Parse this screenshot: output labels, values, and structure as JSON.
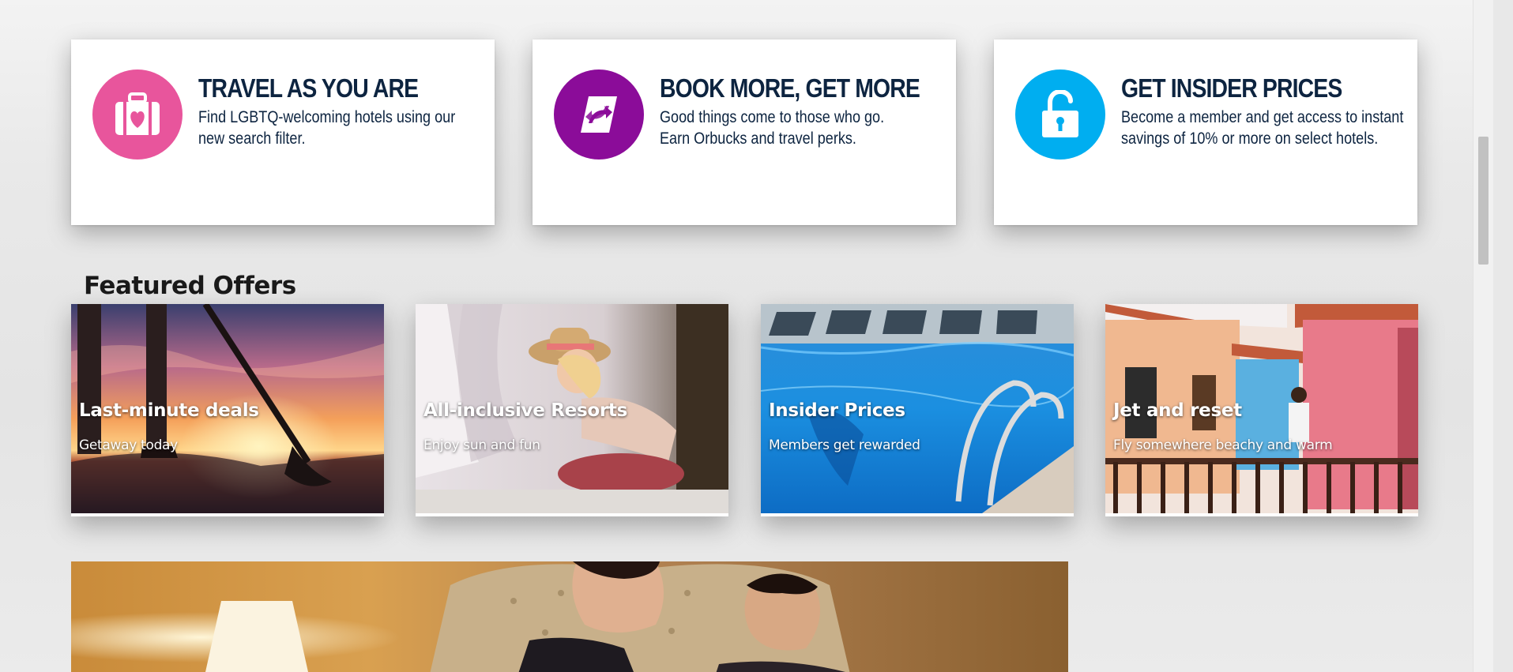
{
  "benefits": [
    {
      "title": "TRAVEL AS YOU ARE",
      "desc_line1": "Find LGBTQ-welcoming hotels using our",
      "desc_line2": "new search filter.",
      "icon": "suitcase-heart-icon",
      "color": "#e8559c"
    },
    {
      "title": "BOOK MORE, GET MORE",
      "desc_line1": "Good things come to those who go.",
      "desc_line2": "Earn Orbucks and travel perks.",
      "icon": "orbucks-swirl-icon",
      "color": "#8b0c99"
    },
    {
      "title": "GET INSIDER PRICES",
      "desc_line1": "Become a member and get access to instant",
      "desc_line2": "savings of 10% or more on select hotels.",
      "icon": "unlocked-padlock-icon",
      "color": "#00aef0"
    }
  ],
  "featured": {
    "heading": "Featured Offers",
    "offers": [
      {
        "title": "Last-minute deals",
        "subtitle": "Getaway today",
        "image": "paddleboard-sunset-photo"
      },
      {
        "title": "All-inclusive Resorts",
        "subtitle": "Enjoy sun and fun",
        "image": "woman-lounging-cabana-photo"
      },
      {
        "title": "Insider Prices",
        "subtitle": "Members get rewarded",
        "image": "hotel-pool-photo"
      },
      {
        "title": "Jet and reset",
        "subtitle": "Fly somewhere beachy and warm",
        "image": "colorful-balcony-photo"
      }
    ]
  },
  "hero": {
    "image": "couple-in-hotel-bed-photo"
  }
}
